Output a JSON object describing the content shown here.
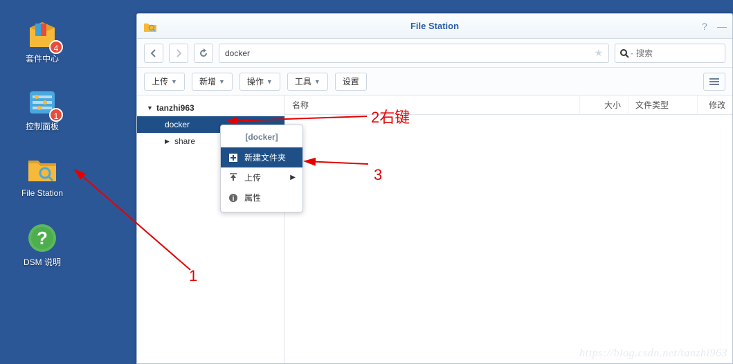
{
  "desktop": {
    "icons": [
      {
        "label": "套件中心",
        "badge": "4"
      },
      {
        "label": "控制面板",
        "badge": "1"
      },
      {
        "label": "File Station",
        "badge": null
      },
      {
        "label": "DSM 说明",
        "badge": null
      }
    ]
  },
  "window": {
    "title": "File Station",
    "path": "docker",
    "search_placeholder": "搜索",
    "toolbar": {
      "upload": "上传",
      "new": "新增",
      "action": "操作",
      "tools": "工具",
      "settings": "设置"
    },
    "tree": {
      "root": "tanzhi963",
      "items": [
        "docker",
        "share"
      ]
    },
    "columns": [
      "名称",
      "大小",
      "文件类型",
      "修改"
    ]
  },
  "context_menu": {
    "title": "[docker]",
    "items": [
      {
        "label": "新建文件夹",
        "selected": true,
        "icon": "plus"
      },
      {
        "label": "上传",
        "submenu": true,
        "icon": "upload"
      },
      {
        "label": "属性",
        "icon": "info"
      }
    ]
  },
  "annotations": {
    "a1": "1",
    "a2": "2右键",
    "a3": "3"
  },
  "watermark": "https://blog.csdn.net/tanzhi963"
}
